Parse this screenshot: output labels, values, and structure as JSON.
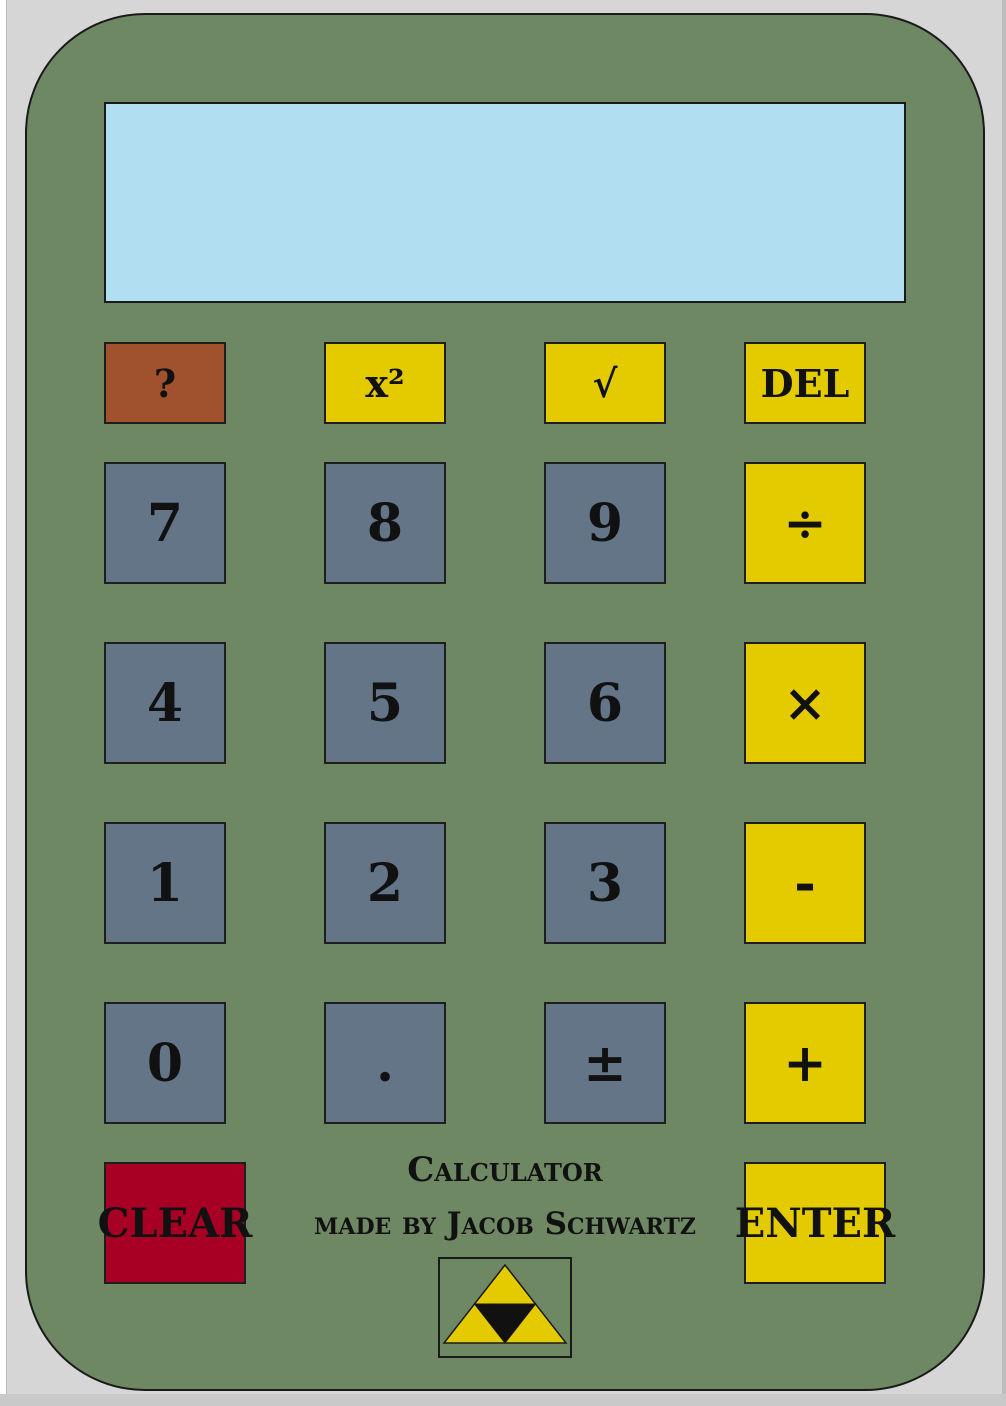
{
  "display": {
    "value": ""
  },
  "keys": {
    "help": "?",
    "square": "x²",
    "sqrt": "√",
    "del": "DEL",
    "seven": "7",
    "eight": "8",
    "nine": "9",
    "divide": "÷",
    "four": "4",
    "five": "5",
    "six": "6",
    "multiply": "×",
    "one": "1",
    "two": "2",
    "three": "3",
    "subtract": "-",
    "zero": "0",
    "decimal": ".",
    "negate": "±",
    "add": "+",
    "clear": "CLEAR",
    "enter": "ENTER"
  },
  "caption": {
    "title": "Calculator",
    "author": "made by Jacob Schwartz"
  },
  "logo": {
    "icon": "triforce-icon"
  },
  "colors": {
    "body": "#6e8863",
    "display": "#b1def0",
    "function_key": "#e3cb00",
    "help_key": "#a0522d",
    "number_key": "#637587",
    "clear_key": "#a80024"
  }
}
